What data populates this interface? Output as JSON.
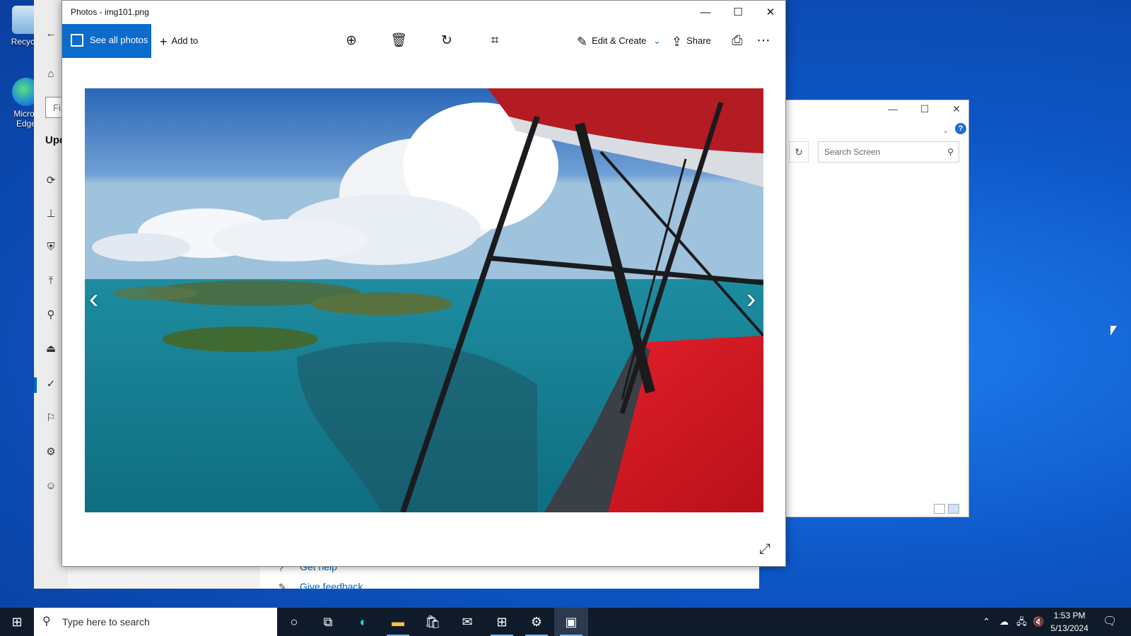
{
  "desktop": {
    "icons": [
      {
        "label": "Recycle",
        "icon": "recycle-bin-icon"
      },
      {
        "label": "Micros Edge",
        "icon": "edge-icon"
      }
    ]
  },
  "settings_bg": {
    "search_stub": "Fi",
    "section_title": "Upd",
    "help_link": "Get help",
    "feedback_link": "Give feedback"
  },
  "explorer_bg": {
    "search_placeholder": "Search Screen"
  },
  "photos": {
    "title": "Photos - img101.png",
    "toolbar": {
      "see_all": "See all photos",
      "add_to": "Add to",
      "edit_create": "Edit & Create",
      "share": "Share"
    }
  },
  "taskbar": {
    "search_placeholder": "Type here to search",
    "time": "1:53 PM",
    "date": "5/13/2024"
  },
  "colors": {
    "accent": "#0b6ccc",
    "desktop": "#0d56c6"
  }
}
